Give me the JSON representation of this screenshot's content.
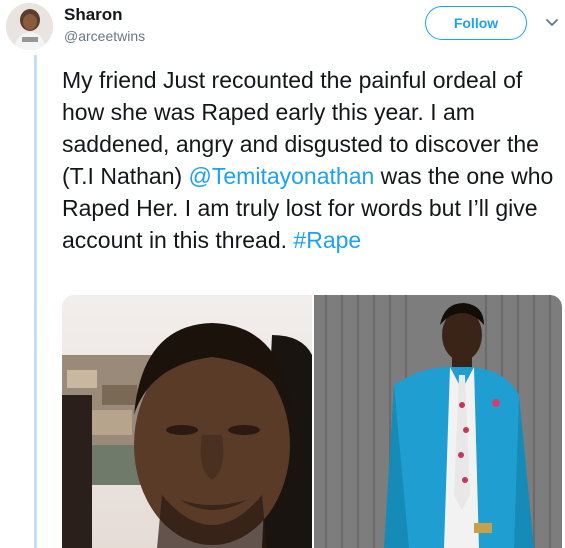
{
  "tweet": {
    "author": {
      "name": "Sharon",
      "handle": "@arceetwins"
    },
    "follow_label": "Follow",
    "text": {
      "part1": "My friend Just recounted the painful ordeal of how she was Raped early this year. I am saddened, angry and disgusted to discover the (T.I Nathan) ",
      "mention": "@Temitayonathan",
      "part2": " was the one who Raped Her. I am truly lost for words but I’ll give account in this thread. ",
      "hashtag": "#Rape"
    }
  },
  "colors": {
    "accent": "#1da1f2",
    "text": "#14171a",
    "secondary": "#657786",
    "thread_line": "#c4dff0"
  },
  "icons": {
    "more": "chevron-down-icon"
  }
}
